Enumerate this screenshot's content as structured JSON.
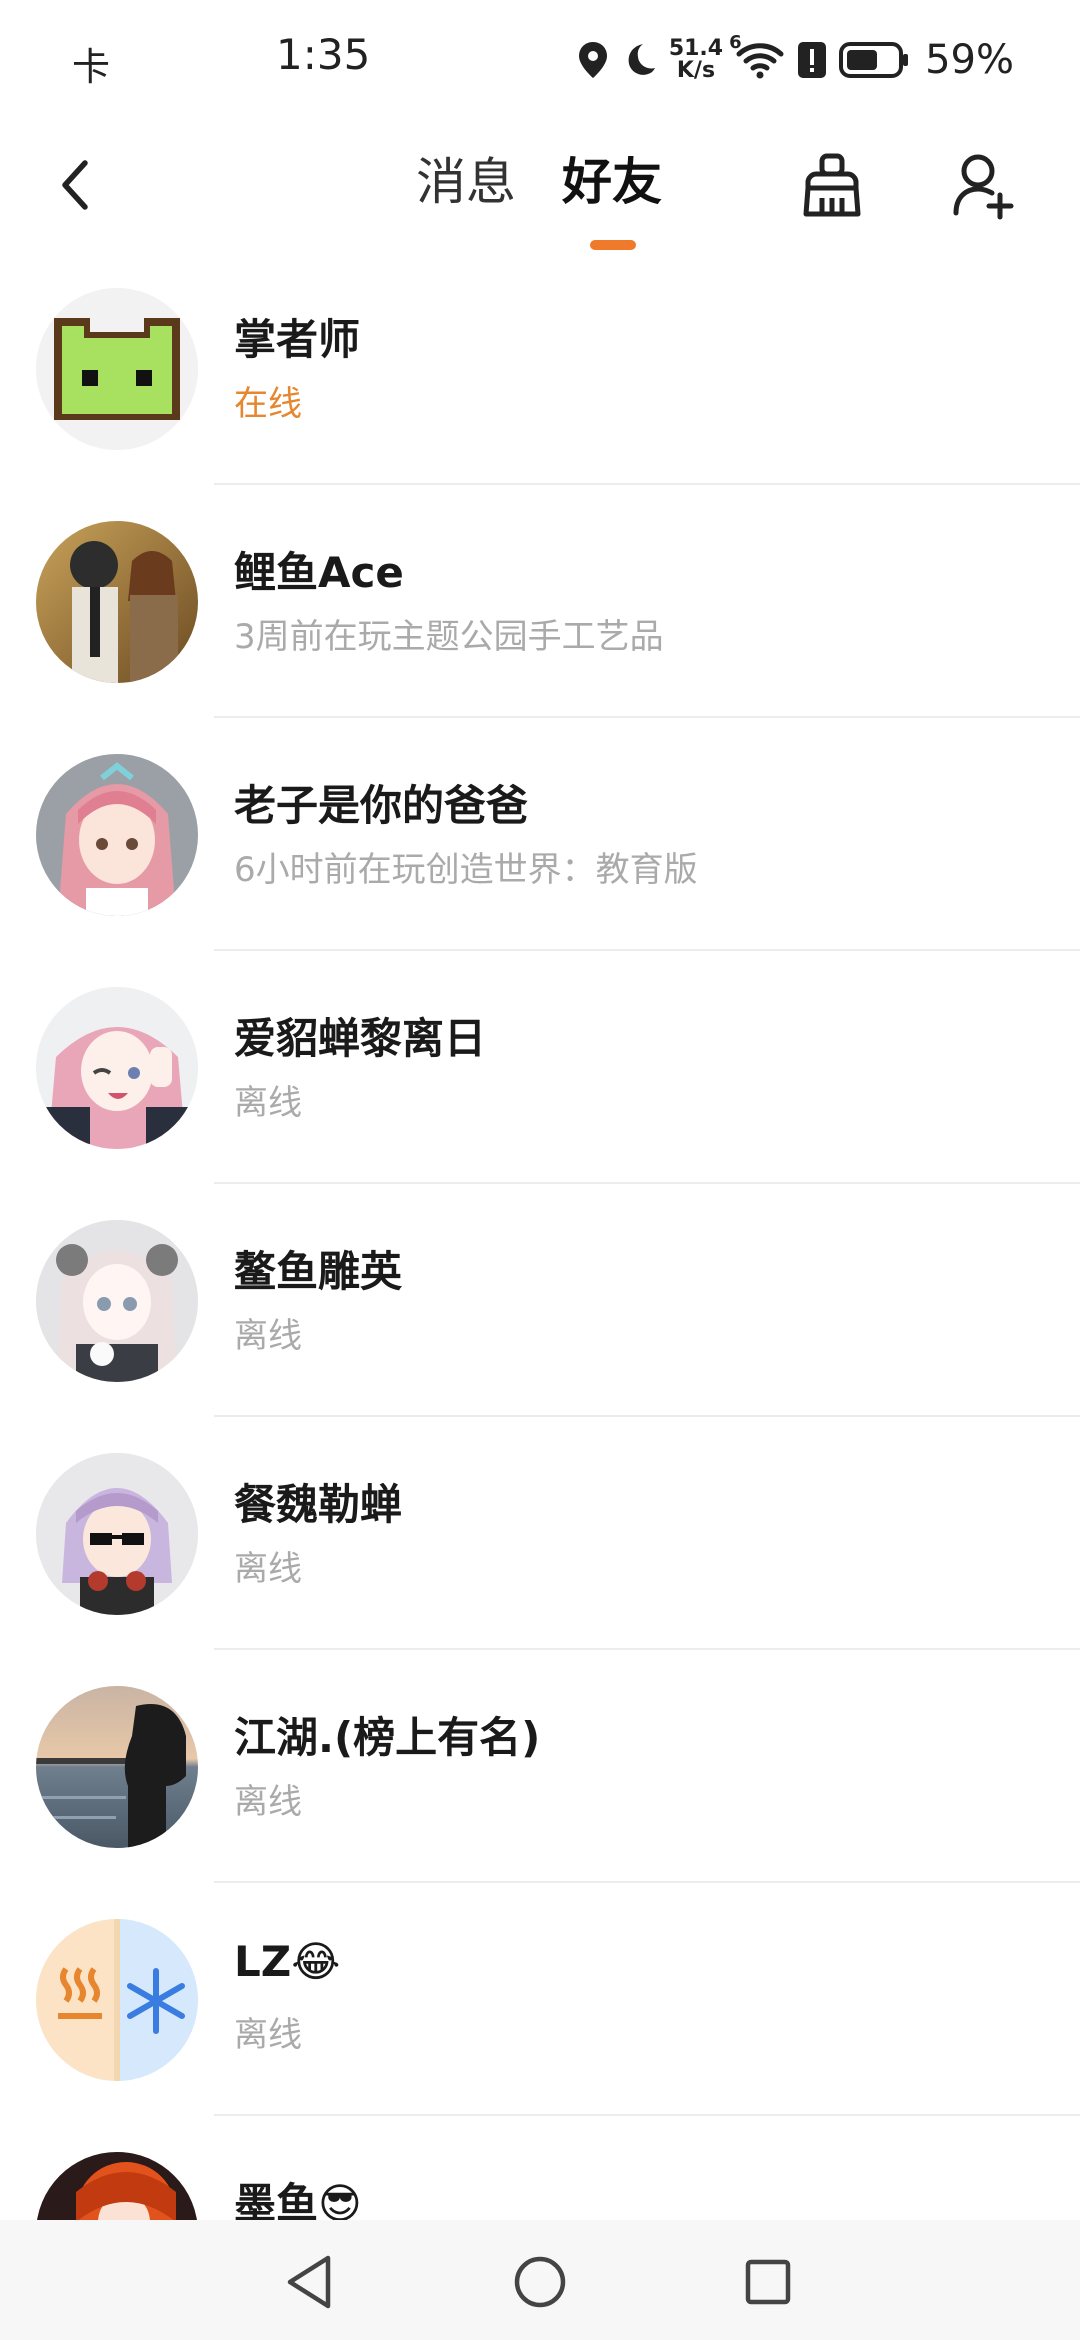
{
  "status_bar": {
    "carrier": "卡",
    "time": "1:35",
    "net_speed_value": "51.4",
    "net_speed_unit": "K/s",
    "wifi_badge": "6",
    "battery_percent": "59%",
    "battery_level": 0.59
  },
  "nav": {
    "tab_messages": "消息",
    "tab_friends": "好友",
    "active_tab": "friends",
    "accent_color": "#f07a2c"
  },
  "friends": [
    {
      "name": "掌者师",
      "status": "在线",
      "online": true,
      "avatar": "green-pixel-cat-avatar"
    },
    {
      "name": "鲤鱼Ace",
      "status": "3周前在玩主题公园手工艺品",
      "online": false,
      "avatar": "pubg-characters-avatar"
    },
    {
      "name": "老子是你的爸爸",
      "status": "6小时前在玩创造世界：教育版",
      "online": false,
      "avatar": "pink-hair-anime-girl-avatar"
    },
    {
      "name": "爱貂蝉黎离日",
      "status": "离线",
      "online": false,
      "avatar": "anime-girl-peace-sign-avatar"
    },
    {
      "name": "鳌鱼雕英",
      "status": "离线",
      "online": false,
      "avatar": "doll-girl-avatar"
    },
    {
      "name": "餐魏勒蝉",
      "status": "离线",
      "online": false,
      "avatar": "purple-hair-sunglasses-avatar"
    },
    {
      "name": "江湖.(榜上有名)",
      "status": "离线",
      "online": false,
      "avatar": "silhouette-sunset-lake-avatar"
    },
    {
      "name": "LZ😂",
      "status": "离线",
      "online": false,
      "avatar": "hot-cold-split-avatar"
    },
    {
      "name": "墨鱼😎",
      "status": "",
      "online": false,
      "avatar": "red-anime-avatar"
    }
  ]
}
